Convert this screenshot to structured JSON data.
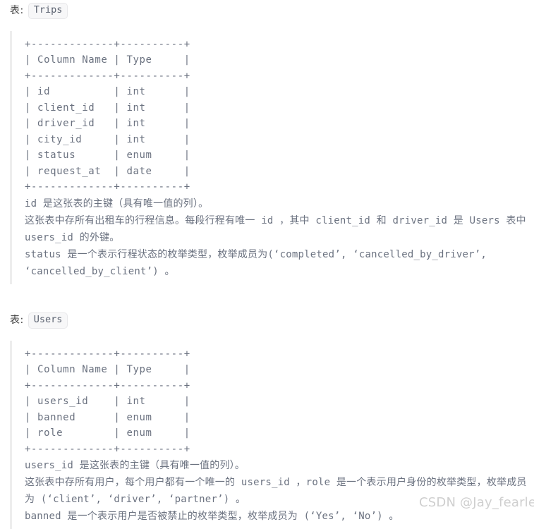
{
  "document": {
    "label_prefix": "表:",
    "watermark": "CSDN @Jay_fearless"
  },
  "tables": [
    {
      "label": "表:",
      "name": "Trips",
      "ascii": "+-------------+----------+\n| Column Name | Type     |\n+-------------+----------+\n| id          | int      |\n| client_id   | int      |\n| driver_id   | int      |\n| city_id     | int      |\n| status      | enum     |\n| request_at  | date     |\n+-------------+----------+",
      "columns_header": [
        "Column Name",
        "Type"
      ],
      "columns": [
        {
          "name": "id",
          "type": "int"
        },
        {
          "name": "client_id",
          "type": "int"
        },
        {
          "name": "driver_id",
          "type": "int"
        },
        {
          "name": "city_id",
          "type": "int"
        },
        {
          "name": "status",
          "type": "enum"
        },
        {
          "name": "request_at",
          "type": "date"
        }
      ],
      "description_lines": [
        "id 是这张表的主键（具有唯一值的列）。",
        "这张表中存所有出租车的行程信息。每段行程有唯一 id ，其中 client_id 和 driver_id 是 Users 表中 users_id 的外键。",
        "status 是一个表示行程状态的枚举类型，枚举成员为(‘completed’, ‘cancelled_by_driver’, ‘cancelled_by_client’) 。"
      ]
    },
    {
      "label": "表:",
      "name": "Users",
      "ascii": "+-------------+----------+\n| Column Name | Type     |\n+-------------+----------+\n| users_id    | int      |\n| banned      | enum     |\n| role        | enum     |\n+-------------+----------+",
      "columns_header": [
        "Column Name",
        "Type"
      ],
      "columns": [
        {
          "name": "users_id",
          "type": "int"
        },
        {
          "name": "banned",
          "type": "enum"
        },
        {
          "name": "role",
          "type": "enum"
        }
      ],
      "description_lines": [
        "users_id 是这张表的主键（具有唯一值的列）。",
        "这张表中存所有用户，每个用户都有一个唯一的 users_id ，role 是一个表示用户身份的枚举类型，枚举成员为 (‘client’, ‘driver’, ‘partner’) 。",
        "banned 是一个表示用户是否被禁止的枚举类型，枚举成员为 (‘Yes’, ‘No’) 。"
      ]
    }
  ]
}
